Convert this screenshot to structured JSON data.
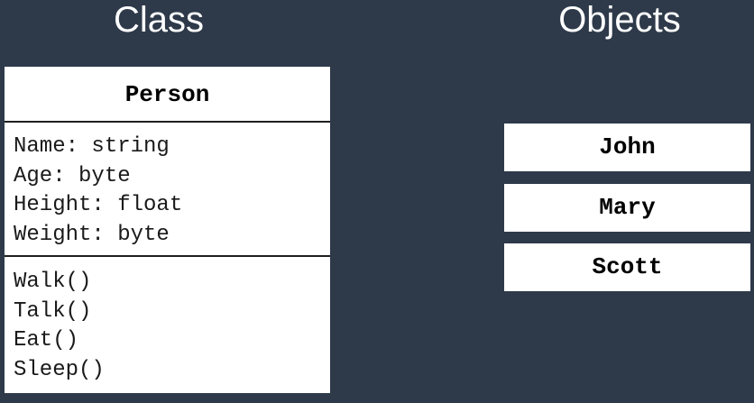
{
  "headings": {
    "class": "Class",
    "objects": "Objects"
  },
  "class_box": {
    "name": "Person",
    "attributes": [
      "Name: string",
      "Age: byte",
      "Height: float",
      "Weight: byte"
    ],
    "methods": [
      "Walk()",
      "Talk()",
      "Eat()",
      "Sleep()"
    ]
  },
  "objects": [
    "John",
    "Mary",
    "Scott"
  ],
  "colors": {
    "background": "#2e3a4a",
    "box_fill": "#ffffff",
    "text": "#000000"
  }
}
